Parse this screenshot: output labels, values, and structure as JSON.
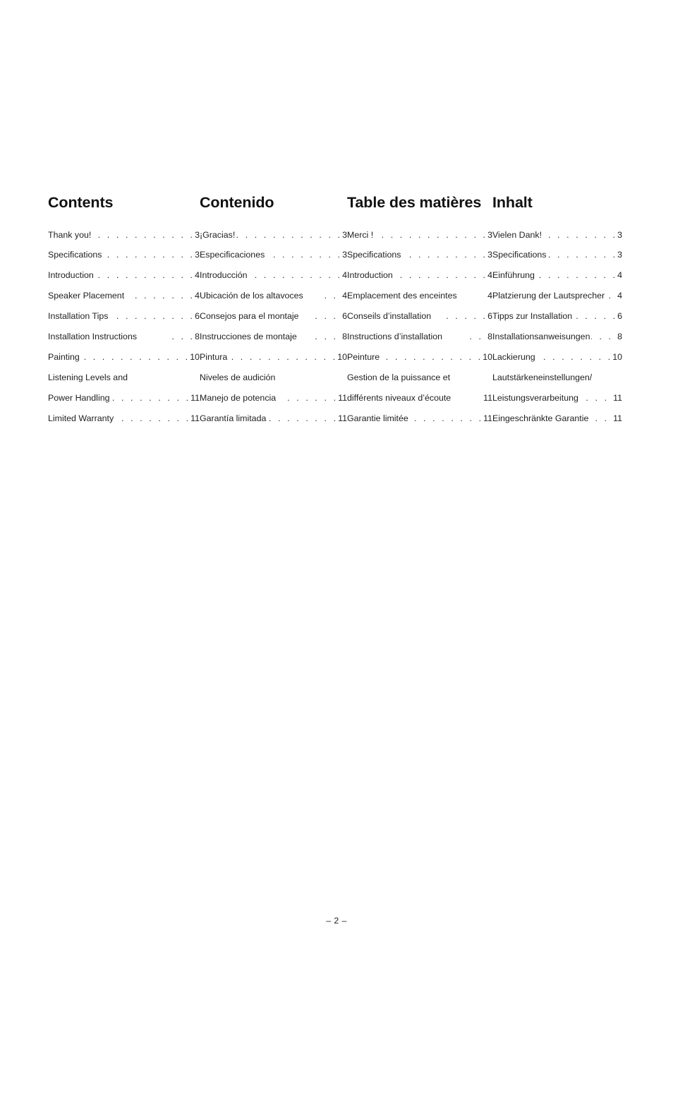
{
  "page": {
    "footer": "– 2 –"
  },
  "columns": [
    {
      "heading": "Contents",
      "entries": [
        {
          "label": "Thank you!",
          "leader": ". . . . . . . . . . . . .",
          "page": "3"
        },
        {
          "label": "Specifications",
          "leader": ". . . . . . . . . . . .",
          "page": "3"
        },
        {
          "label": "Introduction",
          "leader": ". . . . . . . . . . . . .",
          "page": "4"
        },
        {
          "label": "Speaker Placement",
          "leader": ". . . . . . .",
          "page": "4"
        },
        {
          "label": "Installation Tips",
          "leader": ". . . . . . . . .",
          "page": "6"
        },
        {
          "label": "Installation Instructions",
          "leader": ". . .",
          "page": "8"
        },
        {
          "label": "Painting",
          "leader": ". . . . . . . . . . . . . .",
          "page": "10"
        },
        {
          "label": "Listening Levels and",
          "leader": "",
          "page": ""
        },
        {
          "label": "Power Handling",
          "leader": ". . . . . . . . .",
          "page": "11"
        },
        {
          "label": "Limited Warranty",
          "leader": ". . . . . . . .",
          "page": "11"
        }
      ]
    },
    {
      "heading": "Contenido",
      "entries": [
        {
          "label": "¡Gracias!",
          "leader": ". . . . . . . . . . . . . . .",
          "page": "3"
        },
        {
          "label": "Especificaciones",
          "leader": ". . . . . . . . . .",
          "page": "3"
        },
        {
          "label": "Introducción",
          "leader": ". . . . . . . . . . . .",
          "page": "4"
        },
        {
          "label": "Ubicación de los altavoces",
          "leader": ". .",
          "page": "4"
        },
        {
          "label": "Consejos para el montaje",
          "leader": ". . .",
          "page": "6"
        },
        {
          "label": "Instrucciones de montaje",
          "leader": ". . .",
          "page": "8"
        },
        {
          "label": "Pintura",
          "leader": ". . . . . . . . . . . . . . .",
          "page": "10"
        },
        {
          "label": "Niveles de audición",
          "leader": "",
          "page": ""
        },
        {
          "label": "Manejo de potencia",
          "leader": ". . . . . .",
          "page": "11"
        },
        {
          "label": "Garantía limitada",
          "leader": ". . . . . . . .",
          "page": "11"
        }
      ]
    },
    {
      "heading": "Table des matières",
      "entries": [
        {
          "label": "Merci !",
          "leader": ". . . . . . . . . . . . . . . .",
          "page": "3"
        },
        {
          "label": "Specifications",
          "leader": ". . . . . . . . . . . .",
          "page": "3"
        },
        {
          "label": "Introduction",
          "leader": ". . . . . . . . . . . . .",
          "page": "4"
        },
        {
          "label": "Emplacement des enceintes",
          "leader": "",
          "page": "4"
        },
        {
          "label": "Conseils d’installation",
          "leader": ". . . . .",
          "page": "6"
        },
        {
          "label": "Instructions d’installation",
          "leader": ". .",
          "page": "8"
        },
        {
          "label": "Peinture",
          "leader": ". . . . . . . . . . . . . .",
          "page": "10"
        },
        {
          "label": "Gestion de la puissance et",
          "leader": "",
          "page": ""
        },
        {
          "label": "différents niveaux d’écoute",
          "leader": "",
          "page": "11"
        },
        {
          "label": "Garantie limitée",
          "leader": ". . . . . . . . .",
          "page": "11"
        }
      ]
    },
    {
      "heading": "Inhalt",
      "entries": [
        {
          "label": "Vielen Dank!",
          "leader": ". . . . . . . . . . . .",
          "page": "3"
        },
        {
          "label": "Specifications",
          "leader": ". . . . . . . . . . .",
          "page": "3"
        },
        {
          "label": "Einführung",
          "leader": ". . . . . . . . . . . . .",
          "page": "4"
        },
        {
          "label": "Platzierung der Lautsprecher",
          "leader": ".",
          "page": "4"
        },
        {
          "label": "Tipps zur Installation",
          "leader": ". . . . . .",
          "page": "6"
        },
        {
          "label": "Installationsanweisungen",
          "leader": ". . .",
          "page": "8"
        },
        {
          "label": "Lackierung",
          "leader": ". . . . . . . . . . . . .",
          "page": "10"
        },
        {
          "label": "Lautstärkeneinstellungen/",
          "leader": "",
          "page": ""
        },
        {
          "label": "Leistungsverarbeitung",
          "leader": ". . . .",
          "page": "11"
        },
        {
          "label": "Eingeschränkte Garantie",
          "leader": ". .",
          "page": "11"
        }
      ]
    }
  ]
}
